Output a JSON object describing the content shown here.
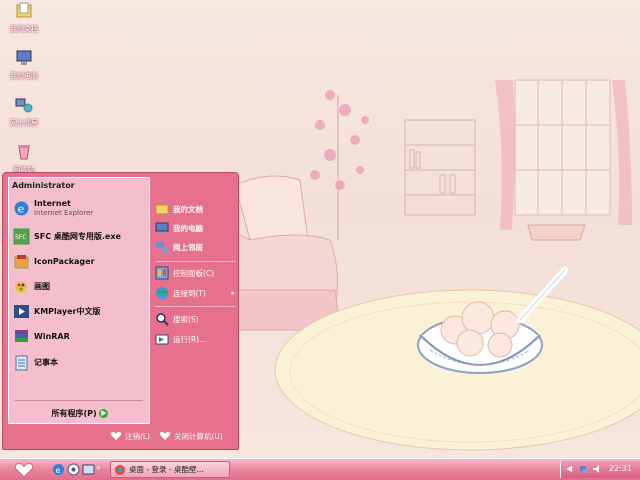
{
  "desktop": {
    "icons": [
      {
        "label": "我的文档",
        "icon": "my-documents-icon"
      },
      {
        "label": "我的电脑",
        "icon": "my-computer-icon"
      },
      {
        "label": "网上邻居",
        "icon": "network-places-icon"
      },
      {
        "label": "回收站",
        "icon": "recycle-bin-icon"
      }
    ]
  },
  "start_menu": {
    "user": "Administrator",
    "pinned": [
      {
        "label": "Internet",
        "sub": "Internet Explorer",
        "icon": "internet-explorer-icon"
      },
      {
        "label": "SFC 桌酷网专用版.exe",
        "icon": "sfc-app-icon"
      },
      {
        "label": "IconPackager",
        "icon": "iconpackager-icon"
      },
      {
        "label": "画图",
        "icon": "paint-icon"
      },
      {
        "label": "KMPlayer中文版",
        "icon": "kmplayer-icon"
      },
      {
        "label": "WinRAR",
        "icon": "winrar-icon"
      },
      {
        "label": "记事本",
        "icon": "notepad-icon"
      }
    ],
    "all_programs": "所有程序(P)",
    "right": [
      {
        "label": "我的文档",
        "icon": "folder-documents-icon"
      },
      {
        "label": "我的电脑",
        "icon": "computer-icon"
      },
      {
        "label": "网上邻居",
        "icon": "network-icon"
      },
      {
        "label": "控制面板(C)",
        "icon": "control-panel-icon"
      },
      {
        "label": "连接到(T)",
        "icon": "connect-icon"
      },
      {
        "label": "搜索(S)",
        "icon": "search-icon"
      },
      {
        "label": "运行(R)...",
        "icon": "run-icon"
      }
    ],
    "logoff": "注销(L)",
    "shutdown": "关闭计算机(U)"
  },
  "taskbar": {
    "task_label": "桌面 - 登录 - 桌酷壁...",
    "clock": "22:31"
  },
  "colors": {
    "accent": "#e8708f",
    "taskbar": "#e9859f",
    "wallpaper": "#f6e5de"
  }
}
